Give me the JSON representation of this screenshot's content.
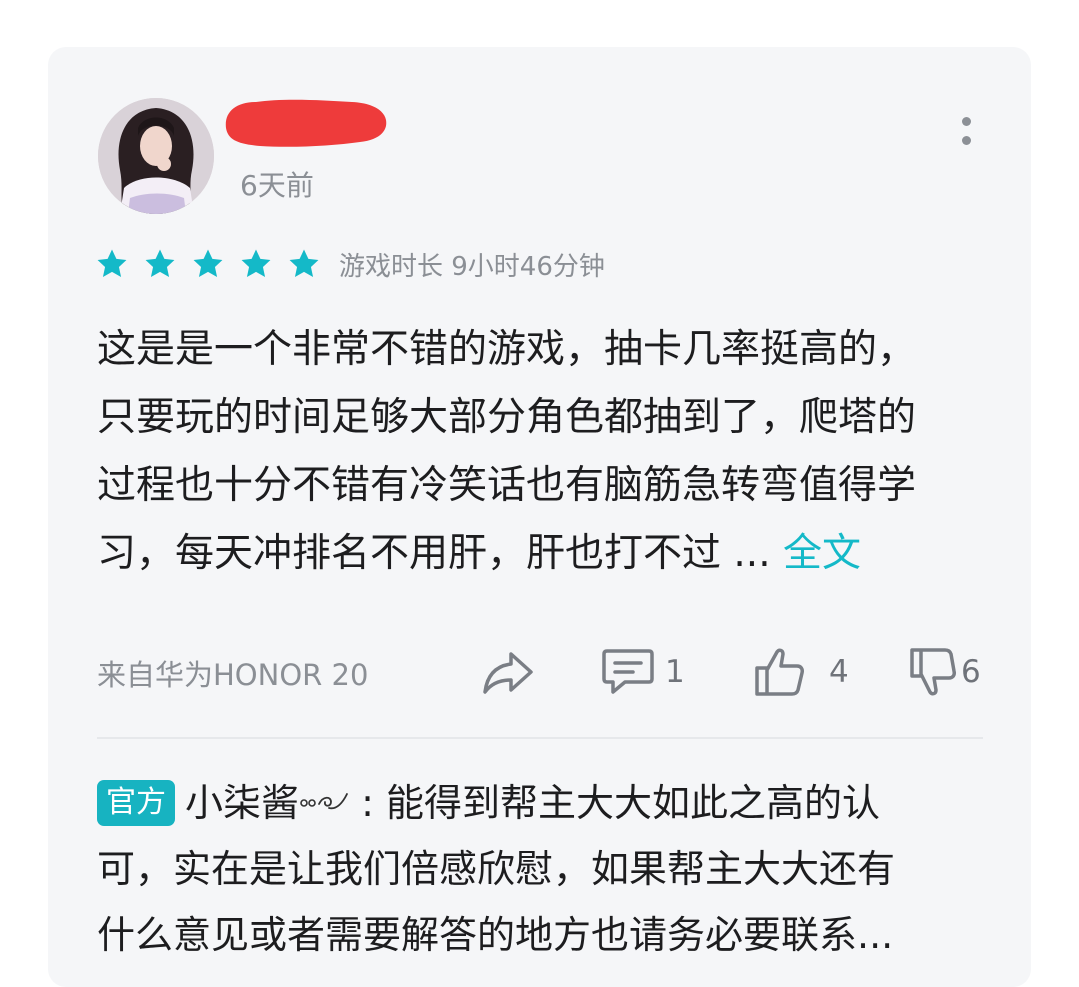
{
  "review": {
    "time_ago": "6天前",
    "rating": 5,
    "playtime": "游戏时长 9小时46分钟",
    "text_lines": [
      "这是是一个非常不错的游戏，抽卡几率挺高的，",
      "只要玩的时间足够大部分角色都抽到了，爬塔的",
      "过程也十分不错有冷笑话也有脑筋急转弯值得学",
      "习，每天冲排名不用肝，肝也打不过 ..."
    ],
    "read_more": "全文",
    "device": "来自华为HONOR 20",
    "comment_count": "1",
    "like_count": "4",
    "dislike_count": "6"
  },
  "reply": {
    "badge": "官方",
    "author": "小柒酱",
    "lines": [
      " : 能得到帮主大大如此之高的认",
      "可，实在是让我们倍感欣慰，如果帮主大大还有",
      "什么意见或者需要解答的地方也请务必要联系..."
    ]
  },
  "colors": {
    "accent": "#14b9c8",
    "card_bg": "#f5f6f8",
    "muted_text": "#8b8f95",
    "redaction": "#ee3b3b"
  }
}
